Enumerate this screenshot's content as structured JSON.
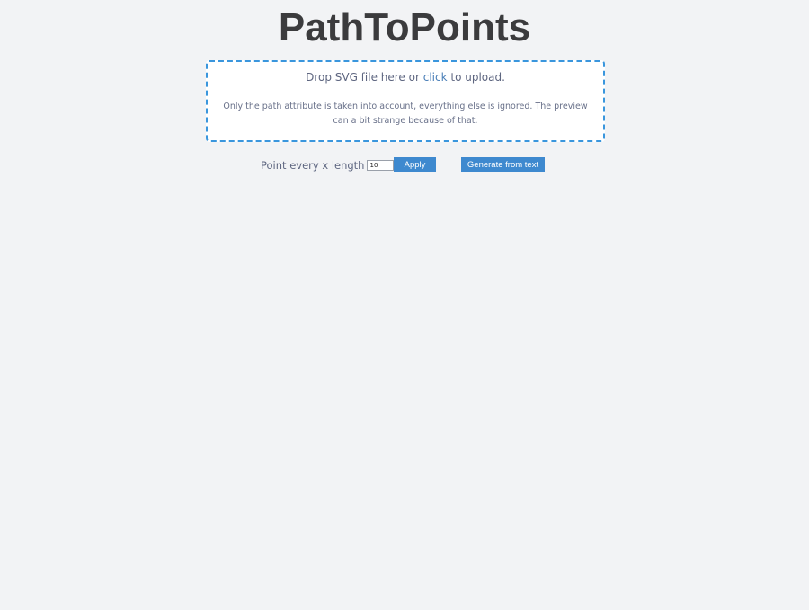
{
  "header": {
    "title": "PathToPoints"
  },
  "dropzone": {
    "text_before": "Drop SVG file here or",
    "click_link": "click",
    "text_after": "to upload.",
    "note": "Only the path attribute is taken into account, everything else is ignored. The preview can a bit strange because of that."
  },
  "controls": {
    "interval_label": "Point every x length",
    "interval_value": "10",
    "apply_label": "Apply",
    "generate_label": "Generate from text"
  },
  "colors": {
    "background": "#f2f3f5",
    "dropzone_border": "#3a96dd",
    "button": "#3e89cf",
    "title": "#3b3b3d"
  }
}
